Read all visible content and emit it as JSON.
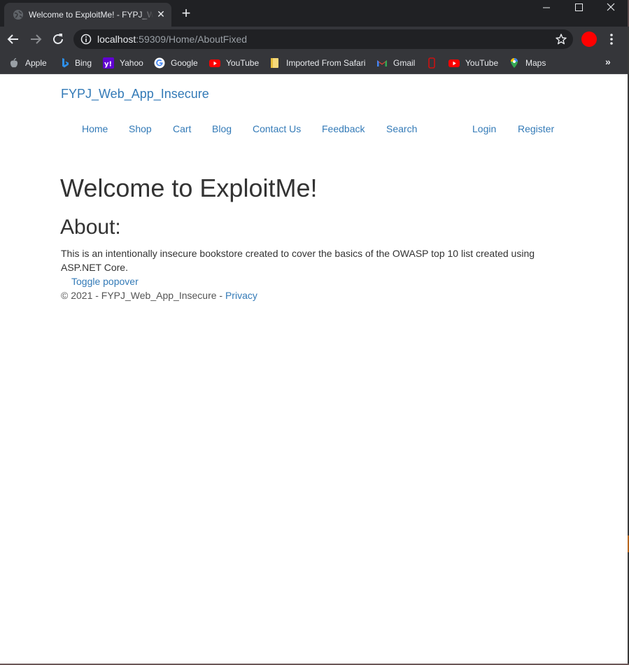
{
  "browser": {
    "tab_title": "Welcome to ExploitMe! - FYPJ_Web_App_Insecure",
    "url_host": "localhost",
    "url_rest": ":59309/Home/AboutFixed",
    "profile_color": "#ff0000",
    "bookmarks": [
      {
        "label": "Apple",
        "icon": "apple-icon"
      },
      {
        "label": "Bing",
        "icon": "bing-icon"
      },
      {
        "label": "Yahoo",
        "icon": "yahoo-icon"
      },
      {
        "label": "Google",
        "icon": "google-icon"
      },
      {
        "label": "YouTube",
        "icon": "youtube-icon"
      },
      {
        "label": "Imported From Safari",
        "icon": "folder-icon"
      },
      {
        "label": "Gmail",
        "icon": "gmail-icon"
      },
      {
        "label": "",
        "icon": "bookmark-favicon-icon"
      },
      {
        "label": "YouTube",
        "icon": "youtube-icon"
      },
      {
        "label": "Maps",
        "icon": "maps-icon"
      }
    ]
  },
  "site": {
    "brand": "FYPJ_Web_App_Insecure",
    "nav": [
      "Home",
      "Shop",
      "Cart",
      "Blog",
      "Contact Us",
      "Feedback",
      "Search"
    ],
    "auth": [
      "Login",
      "Register"
    ],
    "link_color": "#337ab7"
  },
  "content": {
    "heading": "Welcome to ExploitMe!",
    "subheading": "About:",
    "description": "This is an intentionally insecure bookstore created to cover the basics of the OWASP top 10 list created using ASP.NET Core.",
    "popover_label": "Toggle popover"
  },
  "footer": {
    "text": "© 2021 - FYPJ_Web_App_Insecure - ",
    "privacy": "Privacy"
  }
}
